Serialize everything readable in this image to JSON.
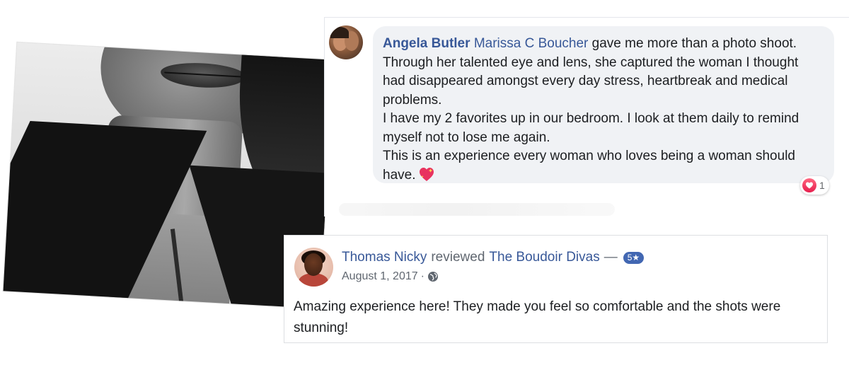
{
  "comment": {
    "author": "Angela Butler",
    "mention": "Marissa C Boucher",
    "text_first": "gave me more than a photo shoot. Through her talented eye and lens, she captured the woman I thought had disappeared amongst every day stress, heartbreak and medical problems.",
    "text_second": "I have my 2 favorites up in our bedroom. I look at them daily to remind myself not to lose me again.",
    "text_third": "This is an experience every woman who loves being a woman should have.",
    "reaction_count": "1",
    "colors": {
      "link": "#385898",
      "bubble": "#f0f2f5",
      "love": "#e61e4d"
    }
  },
  "review": {
    "author": "Thomas Nicky",
    "action": "reviewed",
    "page": "The Boudoir Divas",
    "separator": "—",
    "rating": "5★",
    "date": "August 1, 2017",
    "date_separator": "·",
    "privacy_icon": "globe-icon",
    "text": "Amazing experience here! They made you feel so comfortable and the shots were stunning!"
  },
  "photo": {
    "description_icon": "bw-portrait-photo"
  }
}
